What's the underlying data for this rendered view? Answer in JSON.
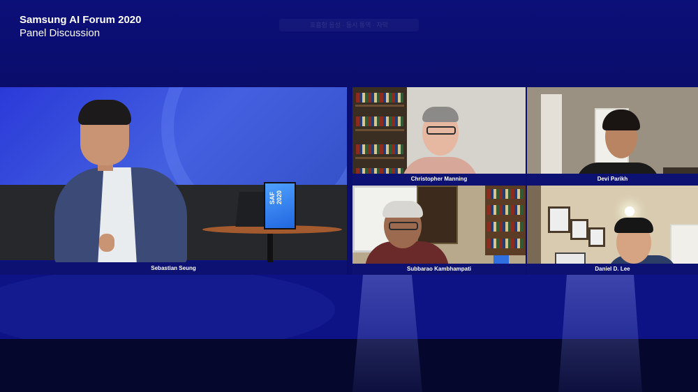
{
  "header": {
    "title": "Samsung AI Forum 2020",
    "subtitle": "Panel Discussion",
    "center_caption": "호흡형 음성 · 동시 통역 · 자막"
  },
  "stage": {
    "sign_text": "SAF 2020"
  },
  "participants": [
    {
      "name": "Sebastian Seung"
    },
    {
      "name": "Christopher Manning"
    },
    {
      "name": "Devi Parikh"
    },
    {
      "name": "Subbarao Kambhampati"
    },
    {
      "name": "Daniel D. Lee"
    }
  ],
  "colors": {
    "background": "#0a0e6e",
    "name_bar": "#0c1172",
    "stage_blue": "#2a3ad8"
  }
}
